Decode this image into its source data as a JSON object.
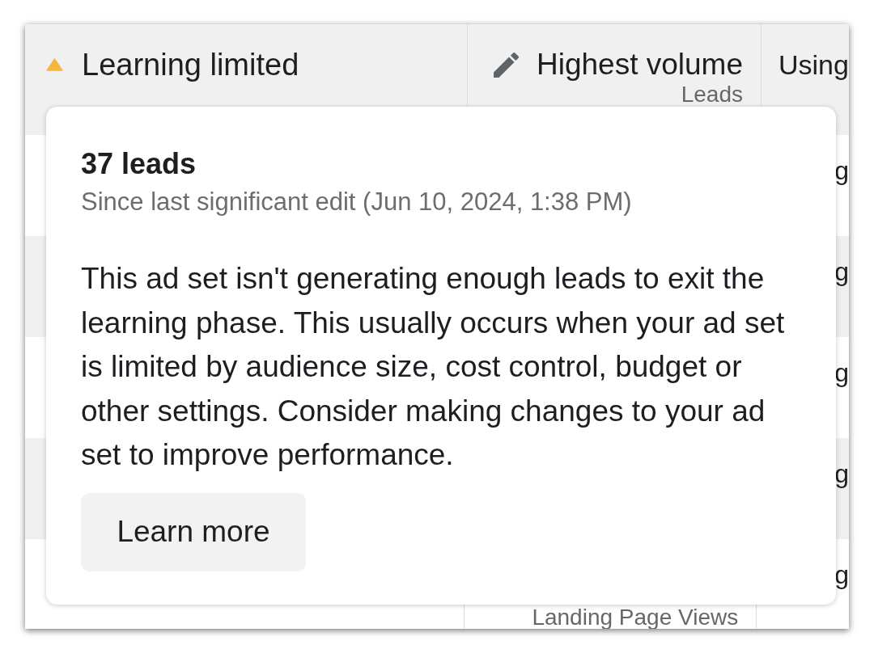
{
  "top_row": {
    "status": "Learning limited",
    "goal": "Highest volume",
    "goal_event": "Leads",
    "column_3": "Using"
  },
  "rows": [
    {
      "column_3": "g"
    },
    {
      "column_3": "g"
    },
    {
      "column_3": "g"
    },
    {
      "column_3": "g"
    },
    {
      "column_2": "Landing Page Views",
      "column_3": "g"
    }
  ],
  "popup": {
    "title": "37 leads",
    "subtitle": "Since last significant edit (Jun 10, 2024, 1:38 PM)",
    "body": "This ad set isn't generating enough leads to exit the learning phase. This usually occurs when your ad set is limited by audience size, cost control, budget or other settings. Consider making changes to your ad set to improve performance.",
    "button": "Learn more"
  }
}
